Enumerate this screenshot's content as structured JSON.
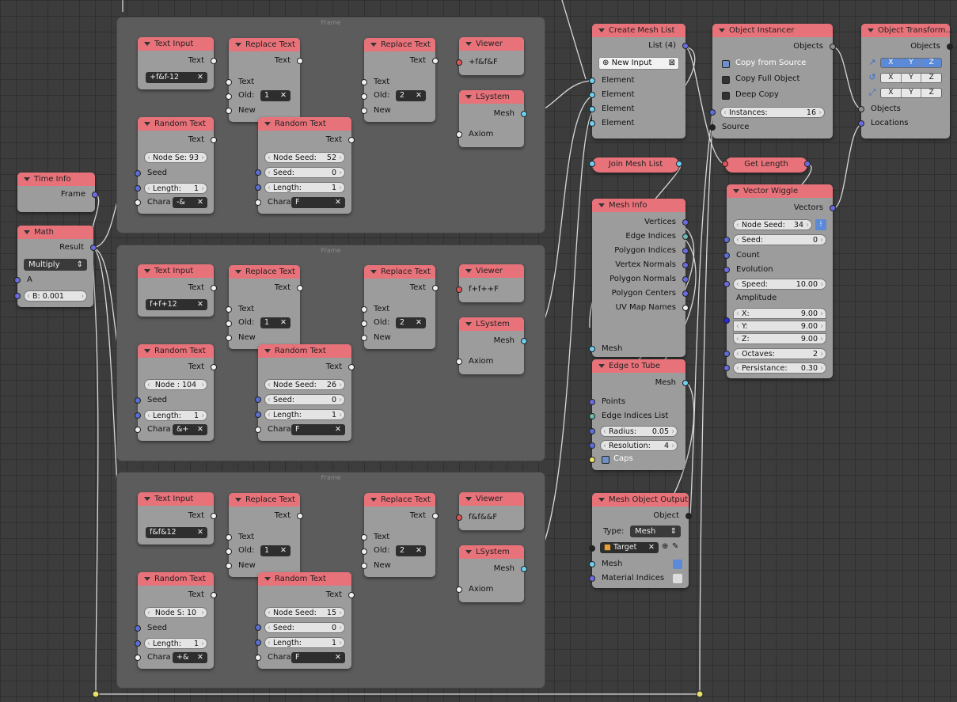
{
  "frames": [
    {
      "label": "Frame"
    },
    {
      "label": "Frame"
    },
    {
      "label": "Frame"
    }
  ],
  "time_info": {
    "title": "Time Info",
    "frame": "Frame"
  },
  "math": {
    "title": "Math",
    "result": "Result",
    "op": "Multiply",
    "a": "A",
    "b_label": "B:",
    "b_value": "0.001"
  },
  "groups": [
    {
      "text_input": {
        "title": "Text Input",
        "out": "Text",
        "value": "+f&f-12"
      },
      "rand1": {
        "title": "Random Text",
        "out": "Text",
        "seed_field": "Node Se: 93",
        "seed": "Seed",
        "len_label": "Length:",
        "len": "1",
        "chara": "Chara",
        "chara_val": "-&"
      },
      "rep1": {
        "title": "Replace Text",
        "out": "Text",
        "in": "Text",
        "old_label": "Old:",
        "old": "1",
        "new": "New"
      },
      "rand2": {
        "title": "Random Text",
        "out": "Text",
        "node_seed": "Node Seed:",
        "node_seed_val": "52",
        "seed_label": "Seed:",
        "seed_val": "0",
        "len_label": "Length:",
        "len": "1",
        "chara": "Chara",
        "chara_val": "F"
      },
      "rep2": {
        "title": "Replace Text",
        "out": "Text",
        "in": "Text",
        "old_label": "Old:",
        "old": "2",
        "new": "New"
      },
      "viewer": {
        "title": "Viewer",
        "value": "+f&f&F"
      },
      "lsys": {
        "title": "LSystem",
        "mesh": "Mesh",
        "axiom": "Axiom"
      }
    },
    {
      "text_input": {
        "title": "Text Input",
        "out": "Text",
        "value": "f+f+12"
      },
      "rand1": {
        "title": "Random Text",
        "out": "Text",
        "seed_field": "Node : 104",
        "seed": "Seed",
        "len_label": "Length:",
        "len": "1",
        "chara": "Chara",
        "chara_val": "&+"
      },
      "rep1": {
        "title": "Replace Text",
        "out": "Text",
        "in": "Text",
        "old_label": "Old:",
        "old": "1",
        "new": "New"
      },
      "rand2": {
        "title": "Random Text",
        "out": "Text",
        "node_seed": "Node Seed:",
        "node_seed_val": "26",
        "seed_label": "Seed:",
        "seed_val": "0",
        "len_label": "Length:",
        "len": "1",
        "chara": "Chara",
        "chara_val": "F"
      },
      "rep2": {
        "title": "Replace Text",
        "out": "Text",
        "in": "Text",
        "old_label": "Old:",
        "old": "2",
        "new": "New"
      },
      "viewer": {
        "title": "Viewer",
        "value": "f+f++F"
      },
      "lsys": {
        "title": "LSystem",
        "mesh": "Mesh",
        "axiom": "Axiom"
      }
    },
    {
      "text_input": {
        "title": "Text Input",
        "out": "Text",
        "value": "f&f&12"
      },
      "rand1": {
        "title": "Random Text",
        "out": "Text",
        "seed_field": "Node S: 10",
        "seed": "Seed",
        "len_label": "Length:",
        "len": "1",
        "chara": "Chara",
        "chara_val": "+&"
      },
      "rep1": {
        "title": "Replace Text",
        "out": "Text",
        "in": "Text",
        "old_label": "Old:",
        "old": "1",
        "new": "New"
      },
      "rand2": {
        "title": "Random Text",
        "out": "Text",
        "node_seed": "Node Seed:",
        "node_seed_val": "15",
        "seed_label": "Seed:",
        "seed_val": "0",
        "len_label": "Length:",
        "len": "1",
        "chara": "Chara",
        "chara_val": "F"
      },
      "rep2": {
        "title": "Replace Text",
        "out": "Text",
        "in": "Text",
        "old_label": "Old:",
        "old": "2",
        "new": "New"
      },
      "viewer": {
        "title": "Viewer",
        "value": "f&f&&F"
      },
      "lsys": {
        "title": "LSystem",
        "mesh": "Mesh",
        "axiom": "Axiom"
      }
    }
  ],
  "create_mesh_list": {
    "title": "Create Mesh List",
    "list": "List (4)",
    "new_input": "New Input",
    "elements": [
      "Element",
      "Element",
      "Element",
      "Element"
    ]
  },
  "join_mesh_list": {
    "title": "Join Mesh List"
  },
  "mesh_info": {
    "title": "Mesh Info",
    "outputs": [
      "Vertices",
      "Edge Indices",
      "Polygon Indices",
      "Vertex Normals",
      "Polygon Normals",
      "Polygon Centers",
      "UV Map Names"
    ],
    "mesh": "Mesh"
  },
  "edge_to_tube": {
    "title": "Edge to Tube",
    "mesh": "Mesh",
    "points": "Points",
    "edge_list": "Edge Indices List",
    "radius_label": "Radius:",
    "radius": "0.05",
    "res_label": "Resolution:",
    "res": "4",
    "caps": "Caps"
  },
  "mesh_object_output": {
    "title": "Mesh Object Output",
    "object": "Object",
    "type_label": "Type:",
    "type": "Mesh",
    "target": "Target",
    "mesh": "Mesh",
    "material": "Material Indices"
  },
  "object_instancer": {
    "title": "Object Instancer",
    "objects": "Objects",
    "copy_source": "Copy from Source",
    "copy_full": "Copy Full Object",
    "deep_copy": "Deep Copy",
    "inst_label": "Instances:",
    "inst": "16",
    "source": "Source"
  },
  "get_length": {
    "title": "Get Length"
  },
  "vector_wiggle": {
    "title": "Vector Wiggle",
    "vectors": "Vectors",
    "node_seed": "Node Seed:",
    "node_seed_val": "34",
    "seed_label": "Seed:",
    "seed_val": "0",
    "count": "Count",
    "evolution": "Evolution",
    "speed_label": "Speed:",
    "speed": "10.00",
    "amplitude": "Amplitude",
    "x_label": "X:",
    "x": "9.00",
    "y_label": "Y:",
    "y": "9.00",
    "z_label": "Z:",
    "z": "9.00",
    "oct_label": "Octaves:",
    "oct": "2",
    "pers_label": "Persistance:",
    "pers": "0.30"
  },
  "object_transforms": {
    "title": "Object Transform...",
    "objects_out": "Objects",
    "axes": [
      "X",
      "Y",
      "Z"
    ],
    "objects_in": "Objects",
    "locations": "Locations"
  }
}
